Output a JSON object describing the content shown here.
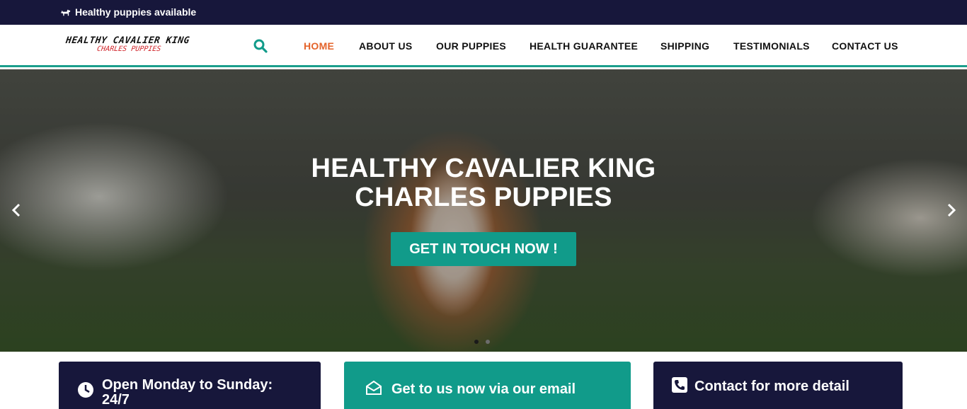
{
  "topbar": {
    "icon": "dog-icon",
    "text": "Healthy puppies available"
  },
  "header": {
    "logo": {
      "line1": "HEALTHY CAVALIER KING",
      "line2": "CHARLES PUPPIES"
    },
    "search_icon": "search-icon",
    "nav": [
      {
        "label": "HOME",
        "active": true
      },
      {
        "label": "ABOUT US",
        "active": false
      },
      {
        "label": "OUR PUPPIES",
        "active": false
      },
      {
        "label": "HEALTH GUARANTEE",
        "active": false
      },
      {
        "label": "SHIPPING",
        "active": false
      },
      {
        "label": "TESTIMONIALS",
        "active": false
      },
      {
        "label": "CONTACT US",
        "active": false
      }
    ]
  },
  "hero": {
    "title_line1": "HEALTHY CAVALIER KING",
    "title_line2": "CHARLES PUPPIES",
    "cta_label": "GET IN TOUCH NOW !",
    "slides_total": 2,
    "slide_active": 1
  },
  "cards": [
    {
      "icon": "clock-icon",
      "text_line1": "Open Monday to Sunday:",
      "text_line2": "24/7"
    },
    {
      "icon": "envelope-open-icon",
      "text_line1": "Get to us now via our email"
    },
    {
      "icon": "phone-icon",
      "text_line1": "Contact for more detail"
    }
  ],
  "colors": {
    "navy": "#17173b",
    "teal": "#119b8a",
    "active_nav": "#e4632a",
    "logo_red": "#d0242a"
  }
}
